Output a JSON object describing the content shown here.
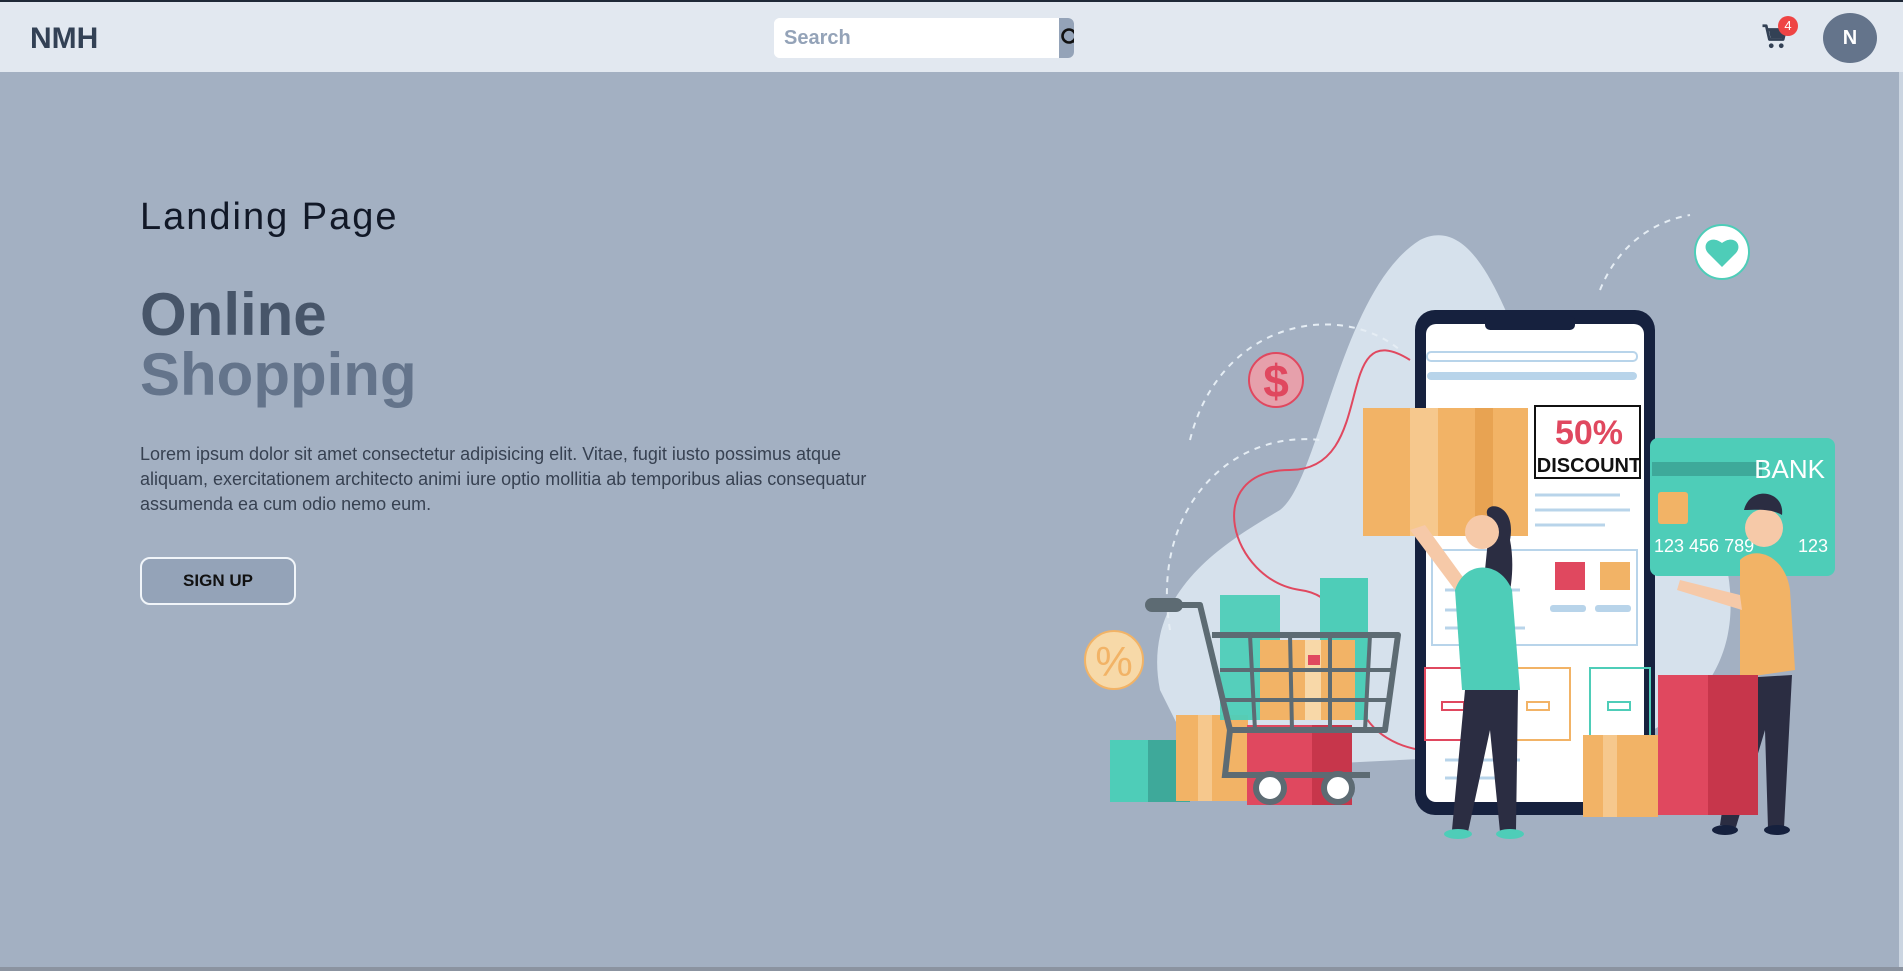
{
  "navbar": {
    "logo": "NMH",
    "search": {
      "placeholder": "Search",
      "value": ""
    },
    "cart_count": "4",
    "avatar_initial": "N"
  },
  "hero": {
    "subtitle": "Landing Page",
    "title_line1": "Online",
    "title_line2": "Shopping",
    "description": "Lorem ipsum dolor sit amet consectetur adipisicing elit. Vitae, fugit iusto possimus atque aliquam, exercitationem architecto animi iure optio mollitia ab temporibus alias consequatur assumenda ea cum odio nemo eum.",
    "cta_label": "SIGN UP"
  },
  "illustration": {
    "discount_percent": "50%",
    "discount_word": "DISCOUNT",
    "card_bank": "BANK",
    "card_number": "123 456 789",
    "card_number_tail": "123",
    "dollar_symbol": "$",
    "percent_symbol": "%"
  },
  "colors": {
    "navbar_bg": "#e2e8f0",
    "page_bg": "#a3b0c2",
    "accent_red": "#e0485f",
    "accent_teal": "#4ecdb8",
    "accent_orange": "#f2b366"
  }
}
